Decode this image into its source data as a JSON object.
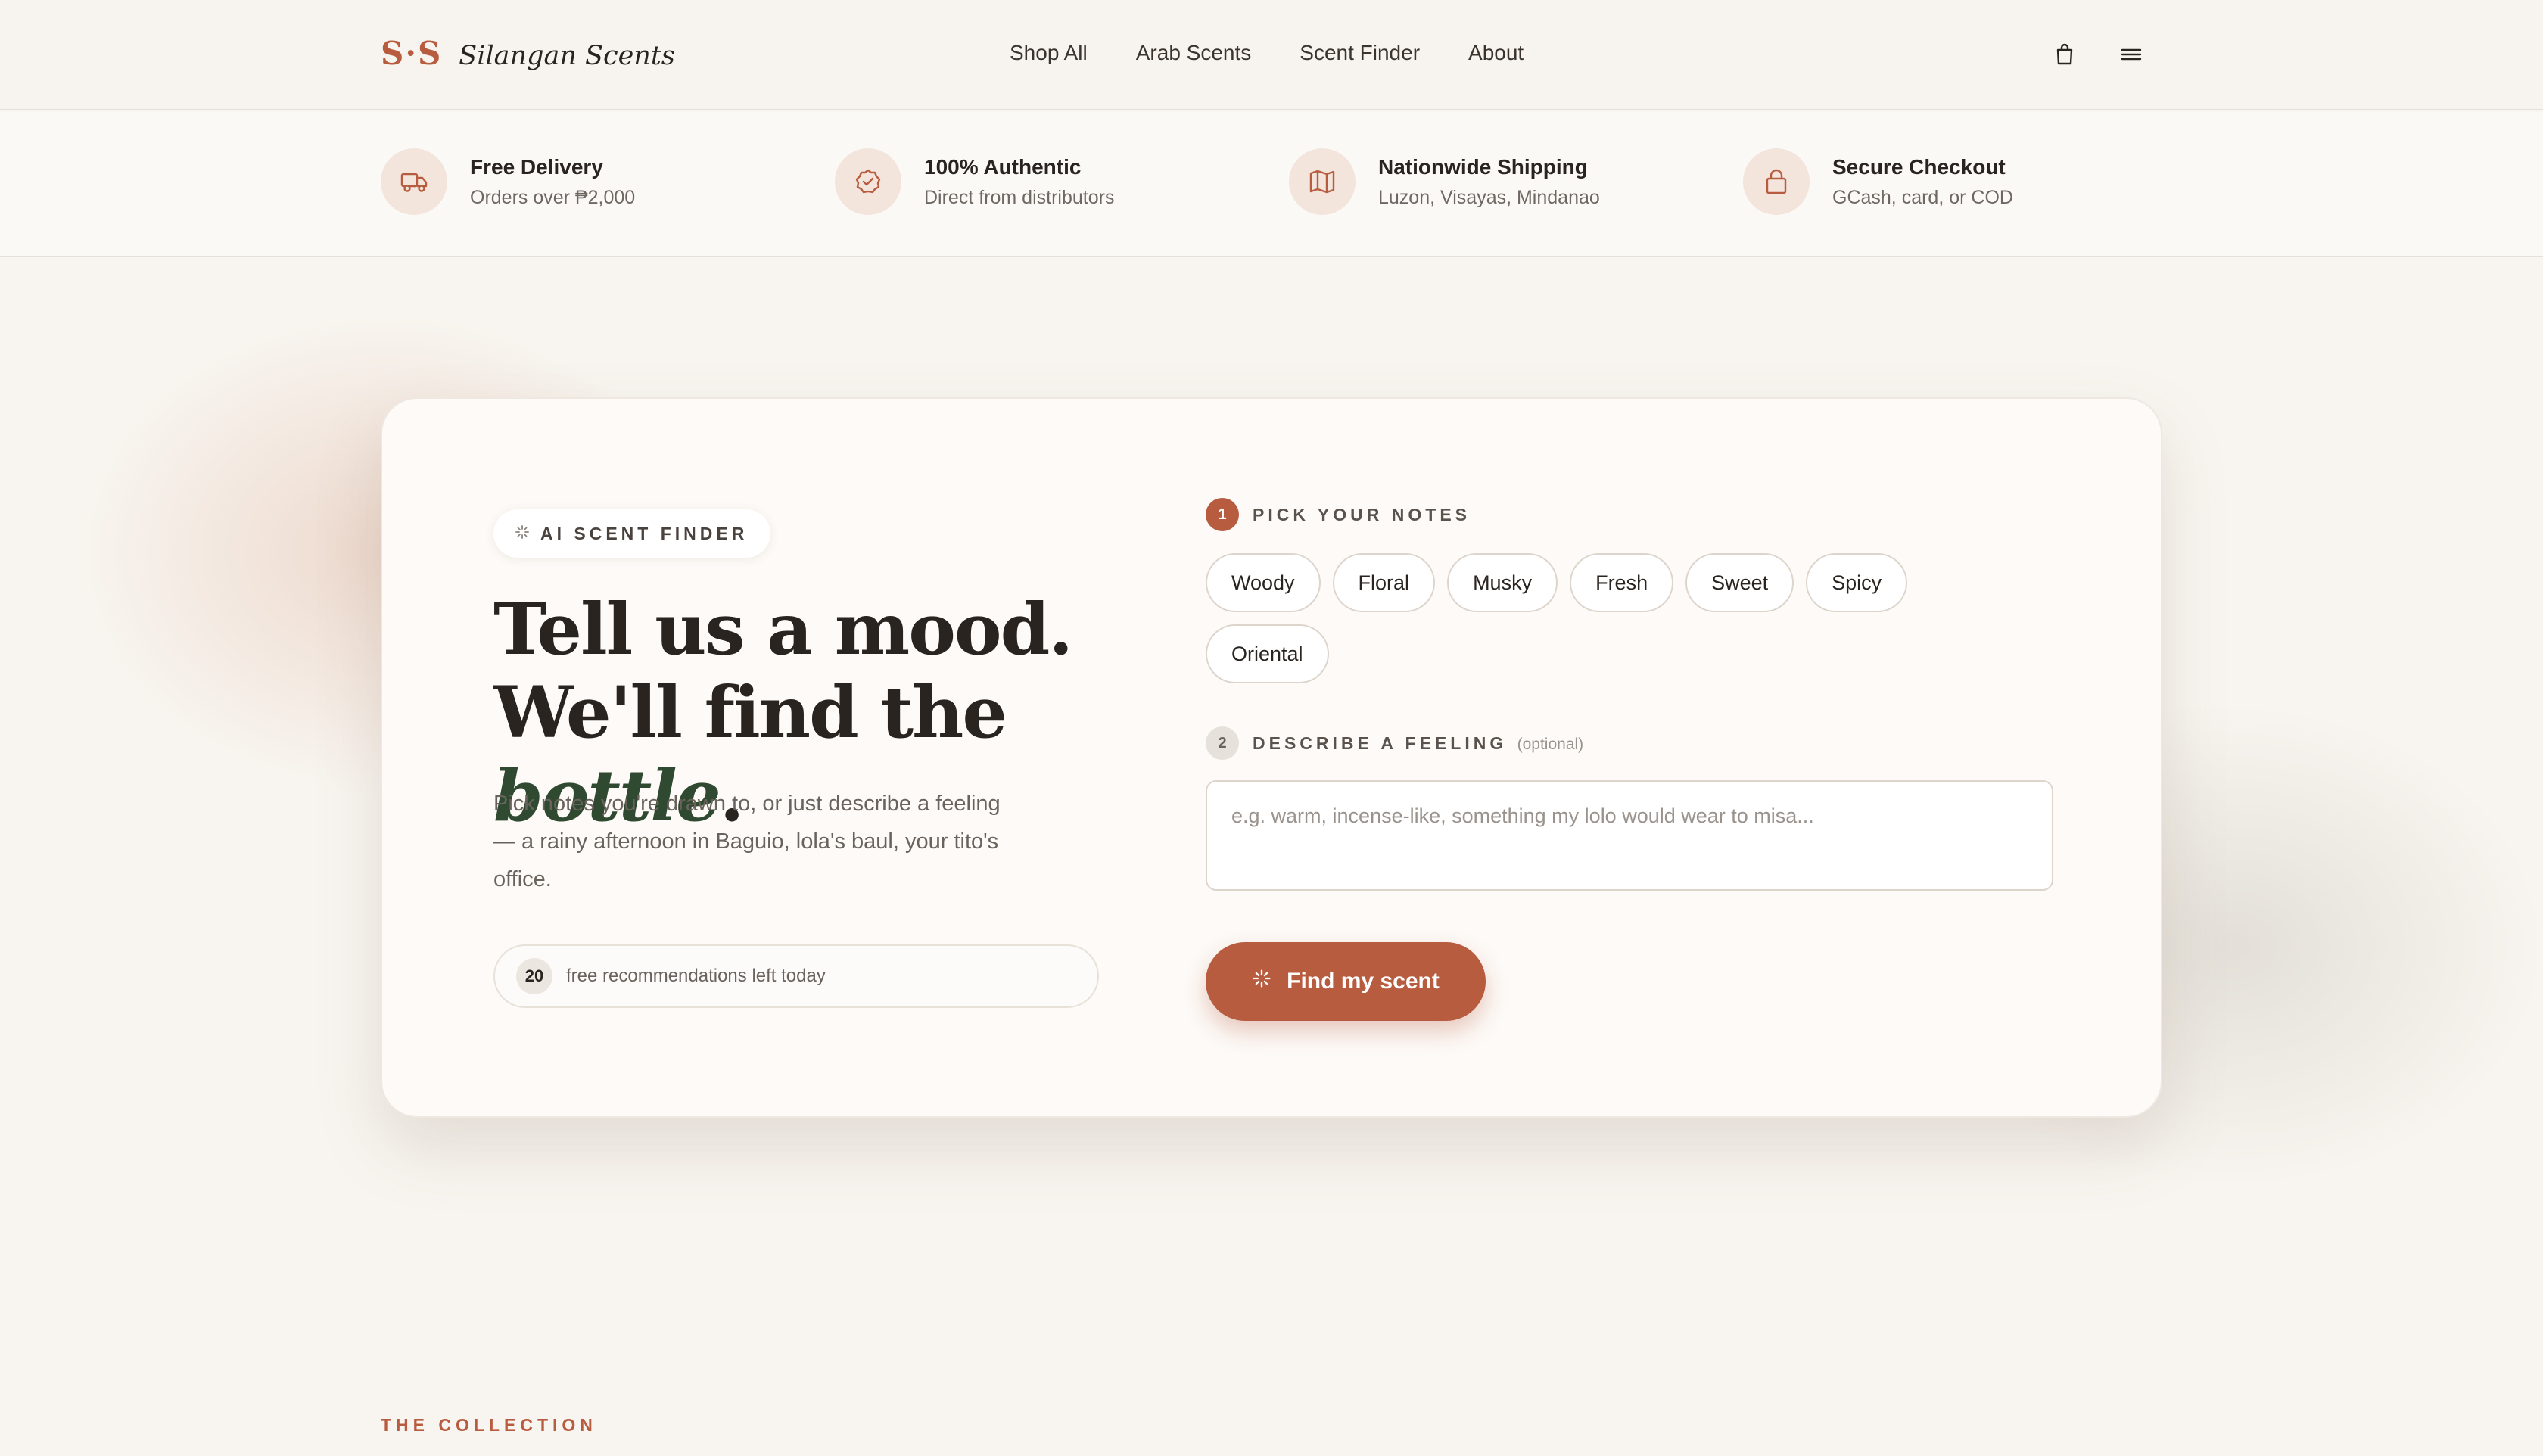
{
  "brand": {
    "mark": "S·S",
    "name": "Silangan Scents",
    "accent": "#b85c40"
  },
  "nav": {
    "items": [
      "Shop All",
      "Arab Scents",
      "Scent Finder",
      "About"
    ]
  },
  "header_icons": [
    "bag-icon",
    "menu-icon"
  ],
  "features": [
    {
      "icon": "truck-icon",
      "title": "Free Delivery",
      "subtitle": "Orders over ₱2,000"
    },
    {
      "icon": "verified-badge-icon",
      "title": "100% Authentic",
      "subtitle": "Direct from distributors"
    },
    {
      "icon": "map-icon",
      "title": "Nationwide Shipping",
      "subtitle": "Luzon, Visayas, Mindanao"
    },
    {
      "icon": "lock-icon",
      "title": "Secure Checkout",
      "subtitle": "GCash, card, or COD"
    }
  ],
  "finder": {
    "badge": "AI SCENT FINDER",
    "headline_line1": "Tell us a mood.",
    "headline_line2_prefix": "We'll find the ",
    "headline_accent": "bottle",
    "headline_suffix": ".",
    "lede": "Pick notes you're drawn to, or just describe a feeling — a rainy afternoon in Baguio, lola's baul, your tito's office.",
    "quota_count": "20",
    "quota_text": "free recommendations left today",
    "step1": {
      "num": "1",
      "label": "PICK YOUR NOTES"
    },
    "notes": [
      "Woody",
      "Floral",
      "Musky",
      "Fresh",
      "Sweet",
      "Spicy",
      "Oriental"
    ],
    "step2": {
      "num": "2",
      "label": "DESCRIBE A FEELING",
      "optional": "(optional)"
    },
    "feeling_placeholder": "e.g. warm, incense-like, something my lolo would wear to misa...",
    "cta_label": "Find my scent"
  },
  "collection_label": "THE COLLECTION"
}
